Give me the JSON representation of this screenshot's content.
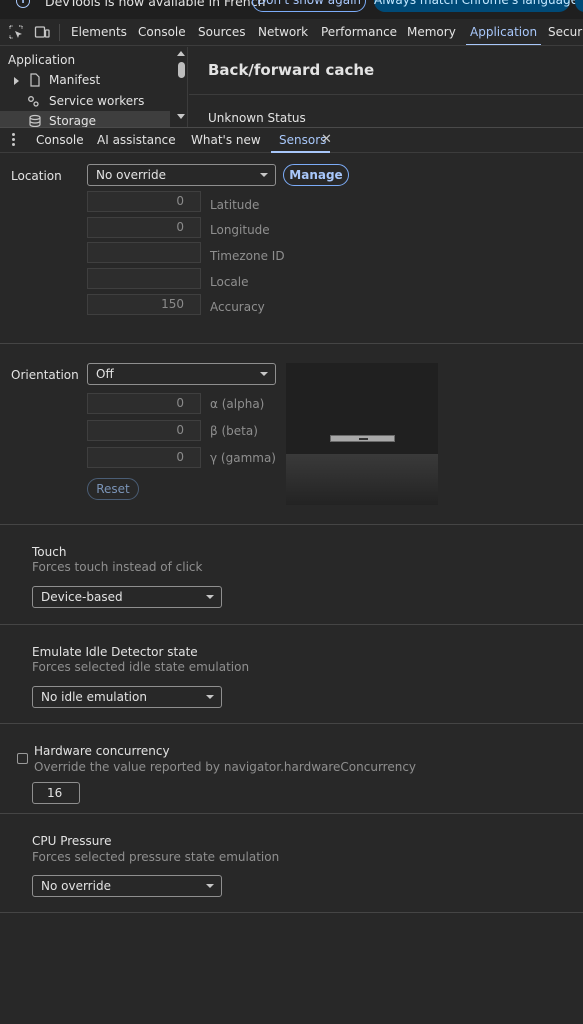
{
  "infobar": {
    "icon": "info-icon",
    "message": "DevTools is now available in French",
    "dont_show_label": "Don't show again",
    "match_language_label": "Always match Chrome's language"
  },
  "main_tabs": [
    "Elements",
    "Console",
    "Sources",
    "Network",
    "Performance",
    "Memory",
    "Application",
    "Securi"
  ],
  "active_main_tab": "Application",
  "application_sidebar": {
    "heading": "Application",
    "items": [
      {
        "label": "Manifest",
        "icon": "document-icon"
      },
      {
        "label": "Service workers",
        "icon": "gear-icon"
      },
      {
        "label": "Storage",
        "icon": "database-icon"
      }
    ]
  },
  "application_main": {
    "title": "Back/forward cache",
    "status": "Unknown Status"
  },
  "drawer_tabs": [
    "Console",
    "AI assistance",
    "What's new",
    "Sensors"
  ],
  "active_drawer_tab": "Sensors",
  "sensors": {
    "location": {
      "label": "Location",
      "selected": "No override",
      "manage_label": "Manage",
      "fields": [
        {
          "value": "0",
          "label": "Latitude"
        },
        {
          "value": "0",
          "label": "Longitude"
        },
        {
          "value": "",
          "label": "Timezone ID"
        },
        {
          "value": "",
          "label": "Locale"
        },
        {
          "value": "150",
          "label": "Accuracy"
        }
      ]
    },
    "orientation": {
      "label": "Orientation",
      "selected": "Off",
      "fields": [
        {
          "value": "0",
          "label": "α (alpha)"
        },
        {
          "value": "0",
          "label": "β (beta)"
        },
        {
          "value": "0",
          "label": "γ (gamma)"
        }
      ],
      "reset_label": "Reset"
    },
    "touch": {
      "title": "Touch",
      "subtitle": "Forces touch instead of click",
      "selected": "Device-based"
    },
    "idle": {
      "title": "Emulate Idle Detector state",
      "subtitle": "Forces selected idle state emulation",
      "selected": "No idle emulation"
    },
    "hardware": {
      "title": "Hardware concurrency",
      "subtitle": "Override the value reported by navigator.hardwareConcurrency",
      "checked": false,
      "value": "16"
    },
    "cpu": {
      "title": "CPU Pressure",
      "subtitle": "Forces selected pressure state emulation",
      "selected": "No override"
    }
  },
  "colors": {
    "background": "#282828",
    "accent": "#a8c7fa",
    "infobar_button": "#004a77"
  }
}
